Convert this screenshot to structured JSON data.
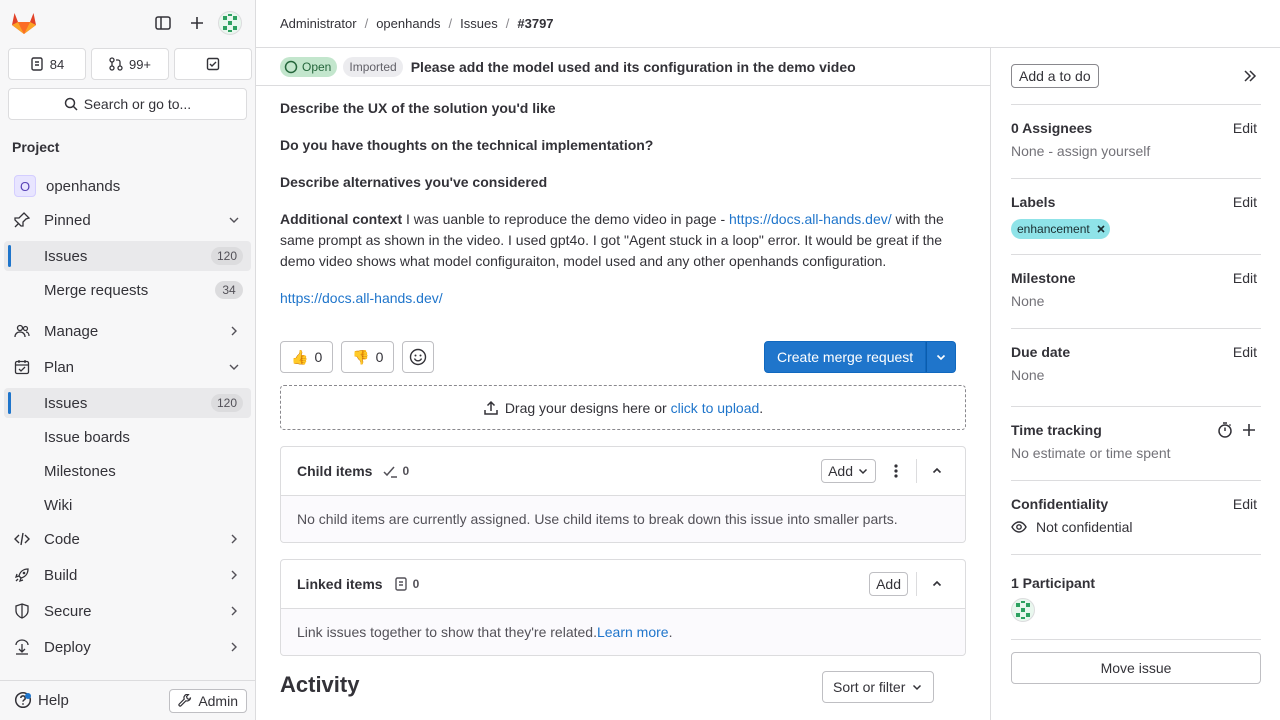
{
  "sidebar": {
    "counters": [
      {
        "icon": "issues-icon",
        "value": "84"
      },
      {
        "icon": "merge-request-icon",
        "value": "99+"
      },
      {
        "icon": "todo-icon",
        "value": ""
      }
    ],
    "search_label": "Search or go to...",
    "section_title": "Project",
    "project": {
      "avatar_letter": "O",
      "name": "openhands"
    },
    "pinned": {
      "label": "Pinned",
      "items": [
        {
          "label": "Issues",
          "count": "120"
        },
        {
          "label": "Merge requests",
          "count": "34"
        }
      ]
    },
    "manage_label": "Manage",
    "plan": {
      "label": "Plan",
      "items": [
        {
          "label": "Issues",
          "count": "120"
        },
        {
          "label": "Issue boards"
        },
        {
          "label": "Milestones"
        },
        {
          "label": "Wiki"
        }
      ]
    },
    "groups": [
      "Code",
      "Build",
      "Secure",
      "Deploy"
    ],
    "help_label": "Help",
    "admin_label": "Admin"
  },
  "breadcrumb": [
    "Administrator",
    "openhands",
    "Issues",
    "#3797"
  ],
  "issue": {
    "status": "Open",
    "imported": "Imported",
    "title": "Please add the model used and its configuration in the demo video",
    "desc": {
      "h1": "Describe the UX of the solution you'd like",
      "h2": "Do you have thoughts on the technical implementation?",
      "h3": "Describe alternatives you've considered",
      "ctx_label": "Additional context",
      "ctx_text1": " I was uanble to reproduce the demo video in page - ",
      "ctx_link": "https://docs.all-hands.dev/",
      "ctx_text2": " with the same prompt as shown in the video. I used gpt4o. I got \"Agent stuck in a loop\" error. It would be great if the demo video shows what model configuraiton, model used and any other openhands configuration.",
      "link2": "https://docs.all-hands.dev/"
    },
    "reactions": {
      "thumbs_up": "0",
      "thumbs_down": "0"
    },
    "create_mr_label": "Create merge request",
    "dropzone": {
      "text": "Drag your designs here or ",
      "link": "click to upload",
      "end": "."
    },
    "child_items": {
      "title": "Child items",
      "count": "0",
      "add_label": "Add",
      "empty": "No child items are currently assigned. Use child items to break down this issue into smaller parts."
    },
    "linked_items": {
      "title": "Linked items",
      "count": "0",
      "add_label": "Add",
      "empty": "Link issues together to show that they're related. ",
      "learn_more": "Learn more",
      "end": "."
    },
    "activity_title": "Activity",
    "sort_label": "Sort or filter"
  },
  "right": {
    "todo_label": "Add a to do",
    "edit_label": "Edit",
    "assignees": {
      "label": "0 Assignees",
      "value": "None - assign yourself"
    },
    "labels": {
      "label": "Labels",
      "pill": "enhancement"
    },
    "milestone": {
      "label": "Milestone",
      "value": "None"
    },
    "due_date": {
      "label": "Due date",
      "value": "None"
    },
    "time_tracking": {
      "label": "Time tracking",
      "value": "No estimate or time spent"
    },
    "confidentiality": {
      "label": "Confidentiality",
      "value": "Not confidential"
    },
    "participants": {
      "label": "1 Participant"
    },
    "move_label": "Move issue"
  },
  "colors": {
    "accent": "#1f75cb",
    "open_badge": "#c3e6cd",
    "label_pill": "#8fe3e8"
  }
}
